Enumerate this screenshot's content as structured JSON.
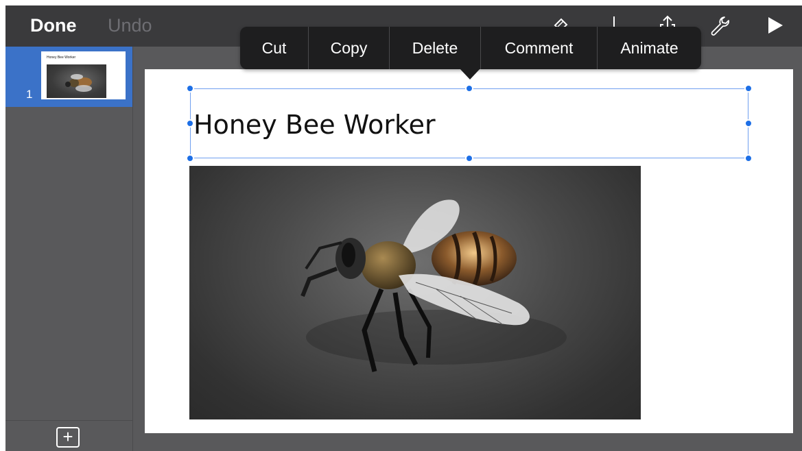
{
  "toolbar": {
    "done_label": "Done",
    "undo_label": "Undo",
    "icons": [
      "format-brush-icon",
      "insert-icon",
      "share-icon",
      "wrench-icon",
      "play-icon"
    ]
  },
  "sidebar": {
    "slides": [
      {
        "number": "1",
        "thumb_title": "Honey Bee Worker",
        "selected": true
      }
    ],
    "add_label": "+"
  },
  "context_menu": {
    "items": [
      "Cut",
      "Copy",
      "Delete",
      "Comment",
      "Animate"
    ]
  },
  "slide": {
    "title": "Honey Bee Worker",
    "image": "honey-bee-photo"
  },
  "colors": {
    "toolbar_bg": "#3a3a3c",
    "selection_blue": "#1d6fe6",
    "sidebar_selected": "#3b72c8"
  }
}
